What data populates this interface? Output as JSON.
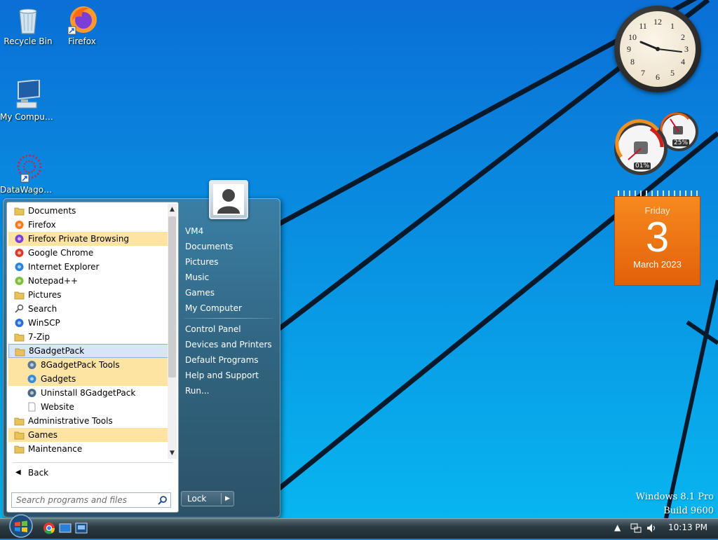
{
  "desktop": {
    "icons": [
      {
        "label": "Recycle Bin",
        "icon": "recycle-bin-icon"
      },
      {
        "label": "Firefox",
        "icon": "firefox-icon"
      },
      {
        "label": "My Computer",
        "icon": "computer-icon"
      },
      {
        "label": "DataWagon...",
        "icon": "datawagon-icon"
      }
    ]
  },
  "gadgets": {
    "clock": {
      "time": "10:13"
    },
    "meter": {
      "cpu_label": "01%",
      "ram_label": "25%"
    },
    "calendar": {
      "weekday": "Friday",
      "day": "3",
      "month_year": "March 2023"
    }
  },
  "start_menu": {
    "programs": [
      {
        "label": "Documents",
        "icon": "folder-icon",
        "state": "normal"
      },
      {
        "label": "Firefox",
        "icon": "firefox-icon",
        "state": "normal"
      },
      {
        "label": "Firefox Private Browsing",
        "icon": "private-browsing-icon",
        "state": "highlight"
      },
      {
        "label": "Google Chrome",
        "icon": "chrome-icon",
        "state": "normal"
      },
      {
        "label": "Internet Explorer",
        "icon": "ie-icon",
        "state": "normal"
      },
      {
        "label": "Notepad++",
        "icon": "notepad-icon",
        "state": "normal"
      },
      {
        "label": "Pictures",
        "icon": "folder-icon",
        "state": "normal"
      },
      {
        "label": "Search",
        "icon": "search-icon",
        "state": "normal"
      },
      {
        "label": "WinSCP",
        "icon": "winscp-icon",
        "state": "normal"
      },
      {
        "label": "7-Zip",
        "icon": "folder-icon",
        "state": "normal"
      },
      {
        "label": "8GadgetPack",
        "icon": "folder-icon",
        "state": "selected"
      },
      {
        "label": "8GadgetPack Tools",
        "icon": "tools-icon",
        "state": "highlight",
        "sub": true
      },
      {
        "label": "Gadgets",
        "icon": "gadgets-icon",
        "state": "highlight",
        "sub": true
      },
      {
        "label": "Uninstall 8GadgetPack",
        "icon": "uninstall-icon",
        "state": "normal",
        "sub": true
      },
      {
        "label": "Website",
        "icon": "document-icon",
        "state": "normal",
        "sub": true
      },
      {
        "label": "Administrative Tools",
        "icon": "folder-icon",
        "state": "normal"
      },
      {
        "label": "Games",
        "icon": "folder-icon",
        "state": "highlight"
      },
      {
        "label": "Maintenance",
        "icon": "folder-icon",
        "state": "normal"
      }
    ],
    "back_label": "Back",
    "search_placeholder": "Search programs and files",
    "right_items": [
      "VM4",
      "Documents",
      "Pictures",
      "Music",
      "Games",
      "My Computer"
    ],
    "right_items_2": [
      "Control Panel",
      "Devices and Printers",
      "Default Programs",
      "Help and Support",
      "Run..."
    ],
    "lock_label": "Lock"
  },
  "os": {
    "line1": "Windows 8.1 Pro",
    "line2": "Build 9600"
  },
  "taskbar": {
    "time": "10:13 PM"
  },
  "colors": {
    "accent": "#0d9bf0",
    "highlight": "#fde4a3",
    "calendar": "#e86f12"
  }
}
